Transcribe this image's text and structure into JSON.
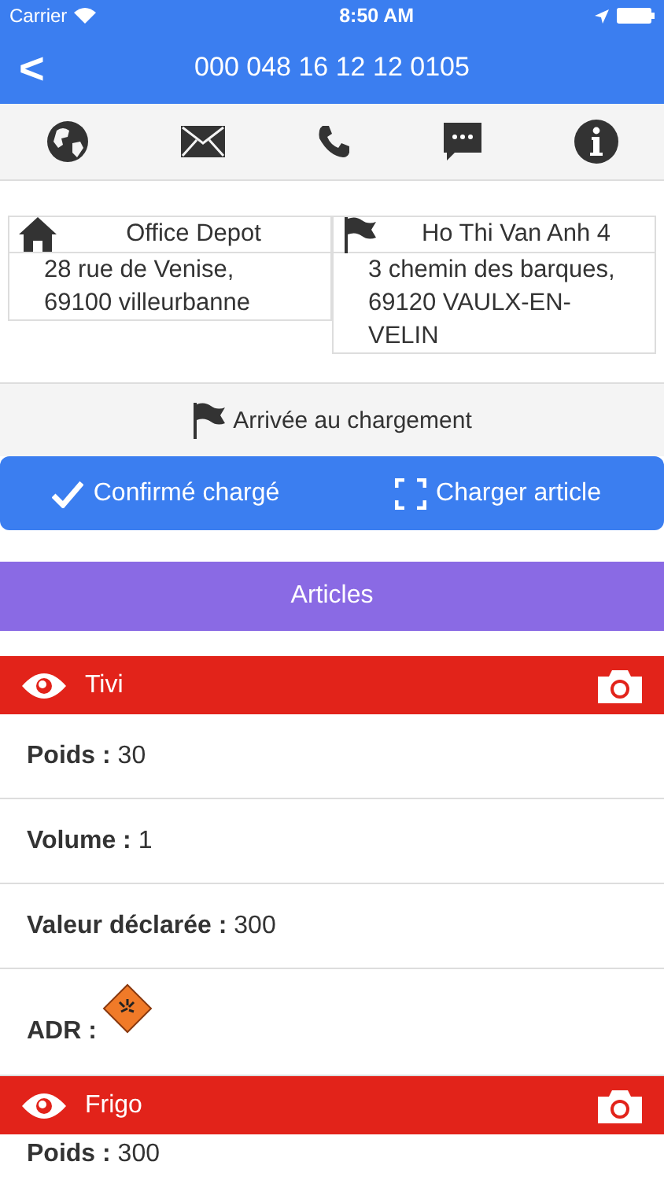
{
  "status_bar": {
    "carrier": "Carrier",
    "time": "8:50 AM"
  },
  "nav": {
    "back": "<",
    "title": "000 048 16 12 12 0105"
  },
  "actions": [
    {
      "kind": "globe"
    },
    {
      "kind": "mail"
    },
    {
      "kind": "phone"
    },
    {
      "kind": "message"
    },
    {
      "kind": "info"
    }
  ],
  "addresses": [
    {
      "kind": "home",
      "name": "Office Depot",
      "address": "28 rue de Venise, 69100 villeurbanne"
    },
    {
      "kind": "flag",
      "name": "Ho Thi Van Anh 4",
      "address": "3 chemin des barques, 69120 VAULX-EN-VELIN"
    }
  ],
  "status": "Arrivée au chargement",
  "buttons": [
    {
      "kind": "check",
      "label": "Confirmé chargé"
    },
    {
      "kind": "scan",
      "label": "Charger article"
    }
  ],
  "section_title": "Articles",
  "articles": [
    {
      "name": "Tivi",
      "fields": [
        {
          "kind": "text",
          "label": "Poids :",
          "value": "30"
        },
        {
          "kind": "text",
          "label": "Volume :",
          "value": "1"
        },
        {
          "kind": "text",
          "label": "Valeur déclarée :",
          "value": "300"
        },
        {
          "kind": "adr",
          "label": "ADR :"
        }
      ]
    },
    {
      "name": "Frigo",
      "fields": [
        {
          "kind": "text",
          "label": "Poids :",
          "value": "300"
        }
      ]
    }
  ]
}
